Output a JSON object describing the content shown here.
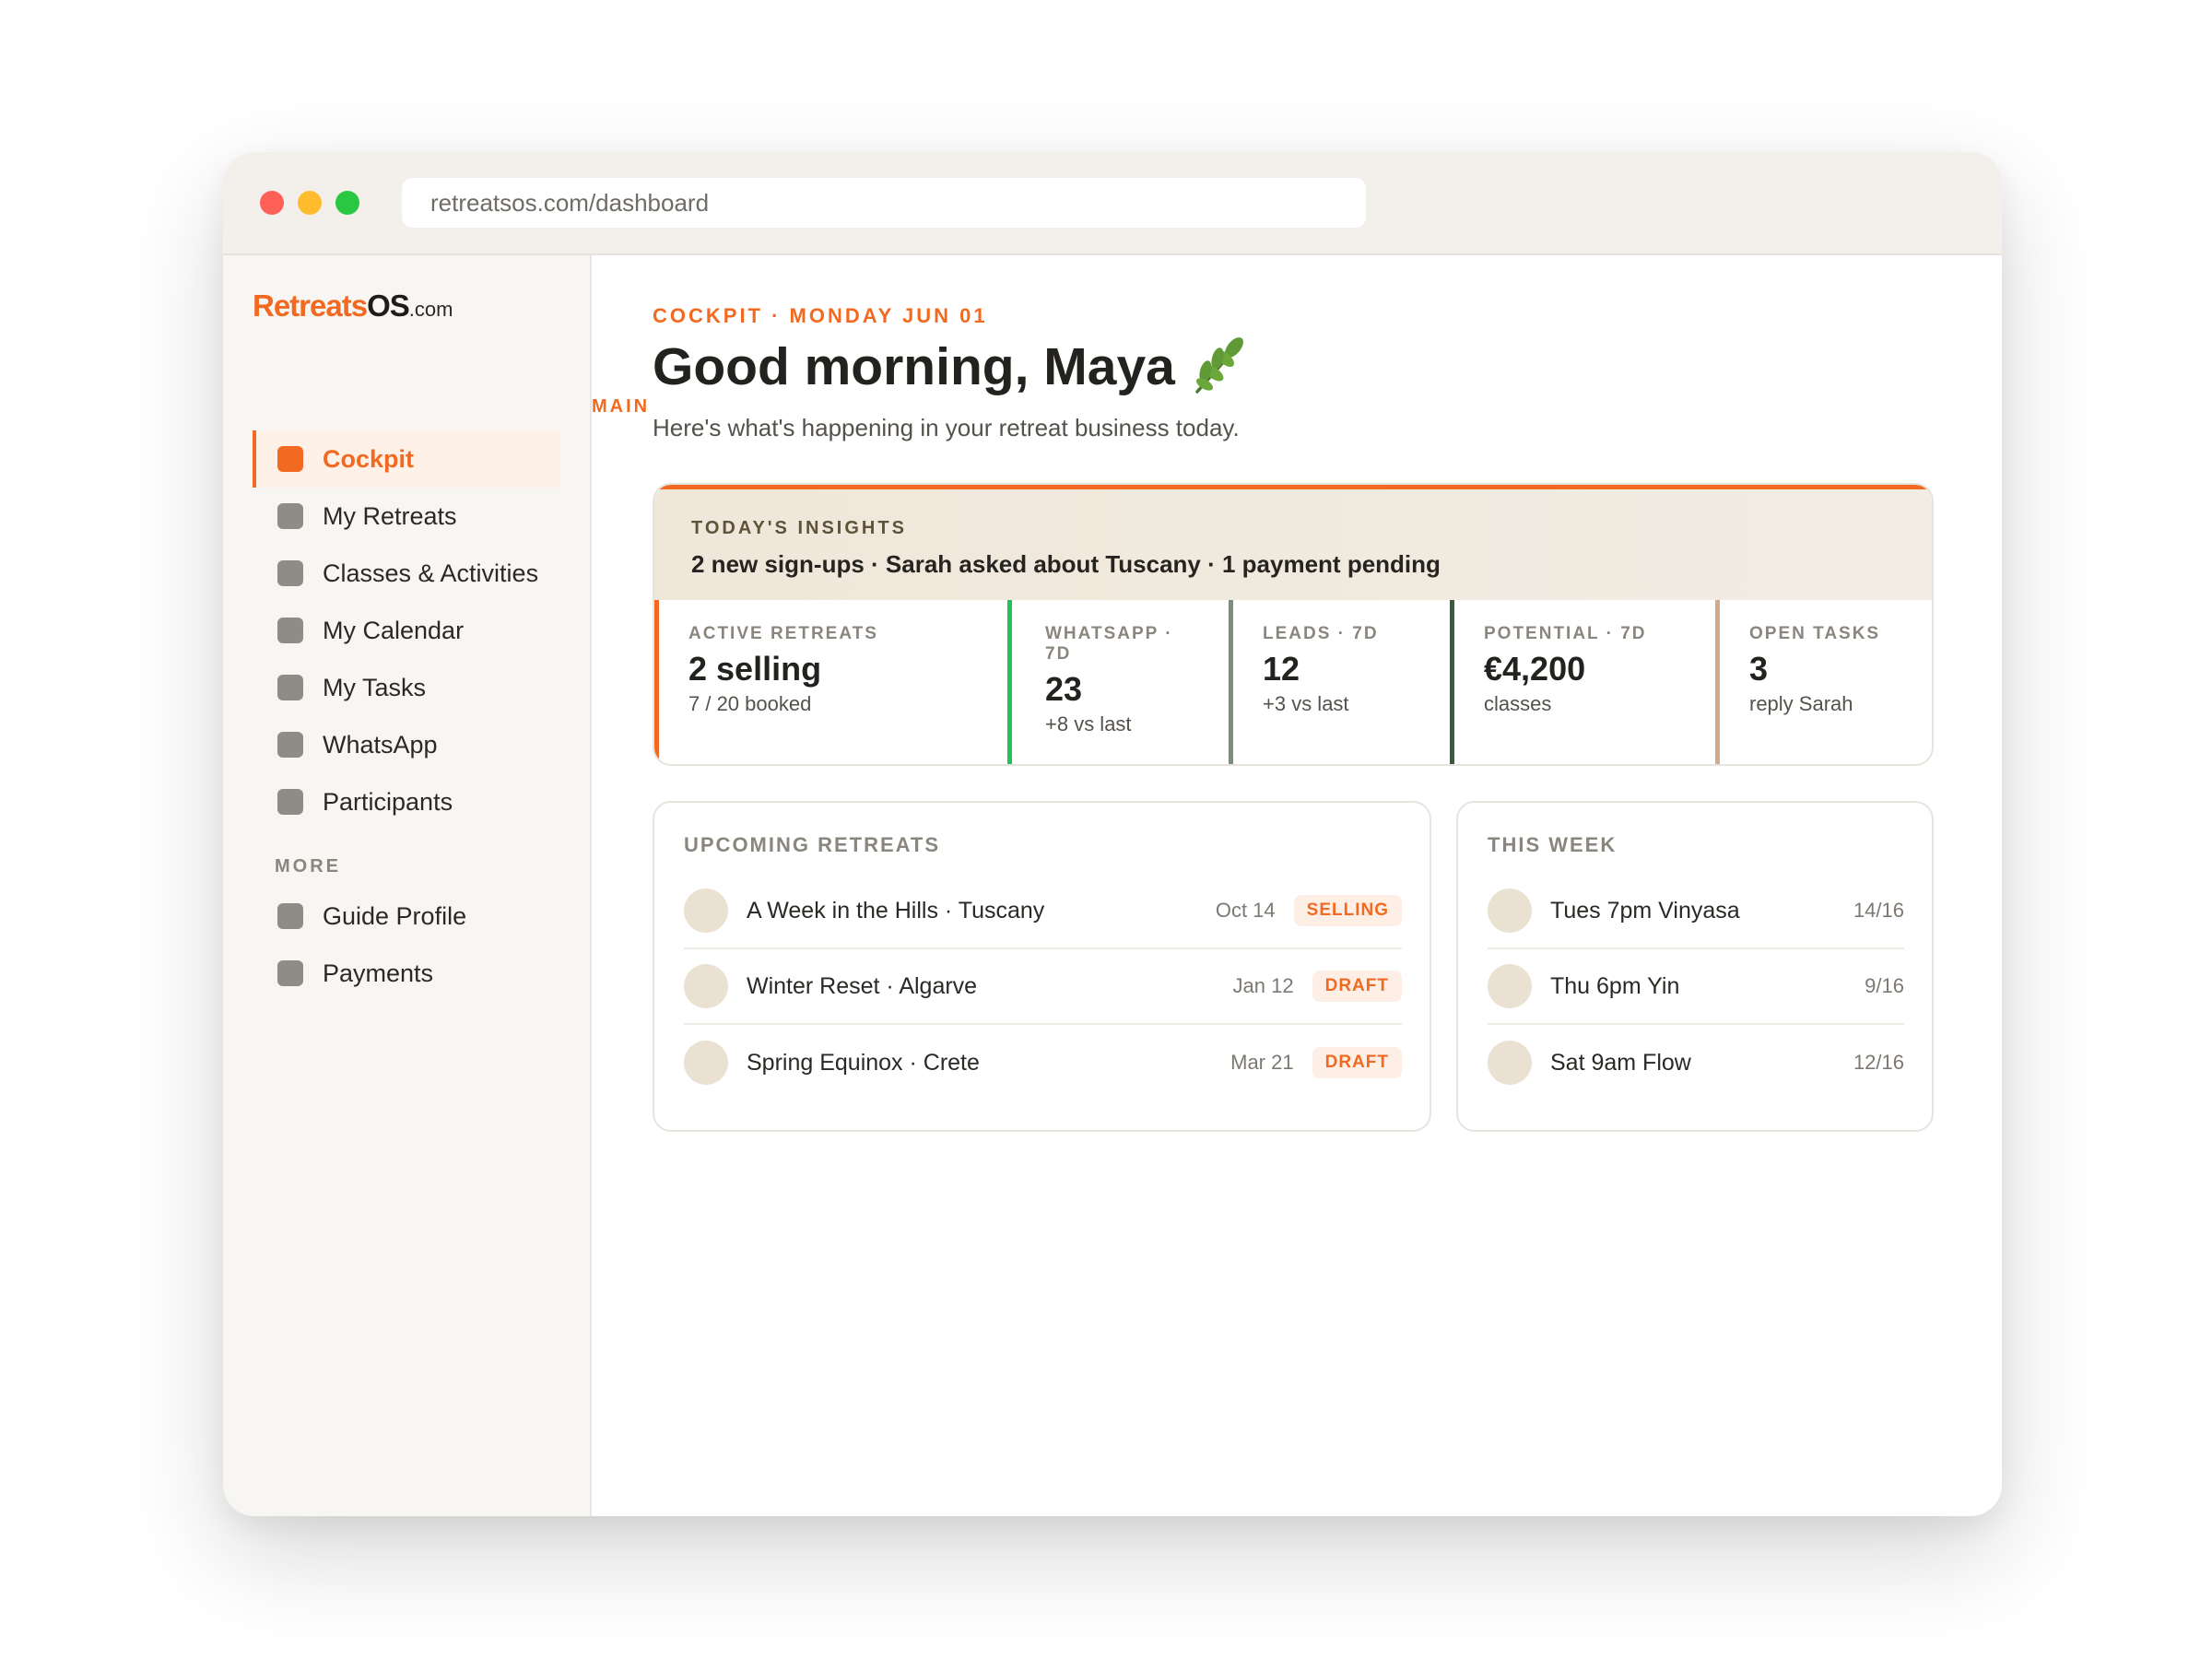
{
  "browser": {
    "url": "retreatsos.com/dashboard"
  },
  "logo": {
    "part1": "Retreats",
    "part2": "OS",
    "part3": ".com"
  },
  "sidebar": {
    "main_label": "MAIN",
    "more_label": "MORE",
    "main_items": [
      {
        "label": "Cockpit",
        "active": true
      },
      {
        "label": "My Retreats"
      },
      {
        "label": "Classes & Activities"
      },
      {
        "label": "My Calendar"
      },
      {
        "label": "My Tasks"
      },
      {
        "label": "WhatsApp"
      },
      {
        "label": "Participants"
      }
    ],
    "more_items": [
      {
        "label": "Guide Profile"
      },
      {
        "label": "Payments"
      }
    ]
  },
  "header": {
    "eyebrow": "COCKPIT · MONDAY JUN 01",
    "greeting": "Good morning, Maya",
    "greeting_icon": "leaf-icon",
    "subtitle": "Here's what's happening in your retreat business today."
  },
  "insights": {
    "label": "TODAY'S INSIGHTS",
    "text": "2 new sign-ups · Sarah asked about Tuscany · 1 payment pending",
    "kpis": [
      {
        "label": "ACTIVE RETREATS",
        "value": "2 selling",
        "sub": "7 / 20 booked",
        "color": "#f26a21"
      },
      {
        "label": "WHATSAPP · 7D",
        "value": "23",
        "sub": "+8 vs last",
        "color": "#25c05a"
      },
      {
        "label": "LEADS · 7D",
        "value": "12",
        "sub": "+3 vs last",
        "color": "#7a8e7c"
      },
      {
        "label": "POTENTIAL · 7D",
        "value": "€4,200",
        "sub": "classes",
        "color": "#3e5a3c"
      },
      {
        "label": "OPEN TASKS",
        "value": "3",
        "sub": "reply Sarah",
        "color": "#d1a98f"
      }
    ]
  },
  "upcoming": {
    "title": "UPCOMING RETREATS",
    "rows": [
      {
        "name": "A Week in the Hills · Tuscany",
        "date": "Oct 14",
        "status": "SELLING"
      },
      {
        "name": "Winter Reset · Algarve",
        "date": "Jan 12",
        "status": "DRAFT"
      },
      {
        "name": "Spring Equinox · Crete",
        "date": "Mar 21",
        "status": "DRAFT"
      }
    ]
  },
  "week": {
    "title": "THIS WEEK",
    "rows": [
      {
        "name": "Tues 7pm Vinyasa",
        "count": "14/16"
      },
      {
        "name": "Thu 6pm Yin",
        "count": "9/16"
      },
      {
        "name": "Sat 9am Flow",
        "count": "12/16"
      }
    ]
  },
  "colors": {
    "accent": "#f26a21",
    "whatsapp": "#25c05a",
    "sidebar_bg": "#f8f6f2"
  }
}
